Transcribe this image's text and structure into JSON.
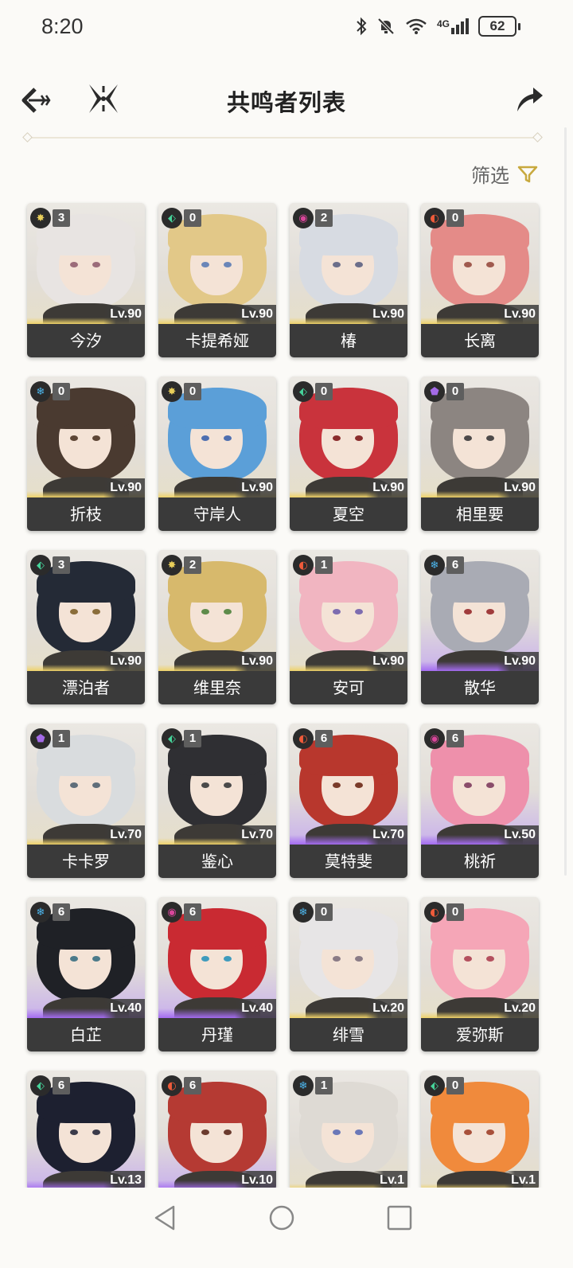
{
  "status_bar": {
    "time": "8:20",
    "network": "4G",
    "battery": "62"
  },
  "header": {
    "title": "共鸣者列表"
  },
  "filter": {
    "label": "筛选"
  },
  "colors": {
    "accent": "#c8a93e",
    "card_name_bg": "#3a3a3a",
    "rarity_gold": "#efd36a",
    "rarity_purple": "#a46cf0"
  },
  "characters": [
    {
      "name": "今汐",
      "level": "Lv.90",
      "constellation": "3",
      "element": "spectro",
      "rarity": "gold",
      "hair": "#e8e4e2",
      "eye": "#9b6c7a"
    },
    {
      "name": "卡提希娅",
      "level": "Lv.90",
      "constellation": "0",
      "element": "aero",
      "rarity": "gold",
      "hair": "#e2c888",
      "eye": "#6a86b8"
    },
    {
      "name": "椿",
      "level": "Lv.90",
      "constellation": "2",
      "element": "havoc",
      "rarity": "gold",
      "hair": "#d7dbe2",
      "eye": "#6b6e8a"
    },
    {
      "name": "长离",
      "level": "Lv.90",
      "constellation": "0",
      "element": "fusion",
      "rarity": "gold",
      "hair": "#e48b88",
      "eye": "#a05a4e"
    },
    {
      "name": "折枝",
      "level": "Lv.90",
      "constellation": "0",
      "element": "glacio",
      "rarity": "gold",
      "hair": "#4a3a30",
      "eye": "#5d4636"
    },
    {
      "name": "守岸人",
      "level": "Lv.90",
      "constellation": "0",
      "element": "spectro",
      "rarity": "gold",
      "hair": "#5b9fd8",
      "eye": "#4e6fb0"
    },
    {
      "name": "夏空",
      "level": "Lv.90",
      "constellation": "0",
      "element": "aero",
      "rarity": "gold",
      "hair": "#c9333c",
      "eye": "#8a2c2c"
    },
    {
      "name": "相里要",
      "level": "Lv.90",
      "constellation": "0",
      "element": "electro",
      "rarity": "gold",
      "hair": "#8c8581",
      "eye": "#4d4a4a"
    },
    {
      "name": "漂泊者",
      "level": "Lv.90",
      "constellation": "3",
      "element": "aero",
      "rarity": "gold",
      "hair": "#242a36",
      "eye": "#8a6d3a"
    },
    {
      "name": "维里奈",
      "level": "Lv.90",
      "constellation": "2",
      "element": "spectro",
      "rarity": "gold",
      "hair": "#d7b96c",
      "eye": "#5e8b4a"
    },
    {
      "name": "安可",
      "level": "Lv.90",
      "constellation": "1",
      "element": "fusion",
      "rarity": "gold",
      "hair": "#f1b5c1",
      "eye": "#7d6cb0"
    },
    {
      "name": "散华",
      "level": "Lv.90",
      "constellation": "6",
      "element": "glacio",
      "rarity": "purple",
      "hair": "#a9abb4",
      "eye": "#a03c3c"
    },
    {
      "name": "卡卡罗",
      "level": "Lv.70",
      "constellation": "1",
      "element": "electro",
      "rarity": "gold",
      "hair": "#d9dcde",
      "eye": "#5f6e7a"
    },
    {
      "name": "鉴心",
      "level": "Lv.70",
      "constellation": "1",
      "element": "aero",
      "rarity": "gold",
      "hair": "#2f2f33",
      "eye": "#4a4a4a"
    },
    {
      "name": "莫特斐",
      "level": "Lv.70",
      "constellation": "6",
      "element": "fusion",
      "rarity": "purple",
      "hair": "#b8372d",
      "eye": "#7a3b2a"
    },
    {
      "name": "桃祈",
      "level": "Lv.50",
      "constellation": "6",
      "element": "havoc",
      "rarity": "purple",
      "hair": "#ee90ab",
      "eye": "#8a4c6a"
    },
    {
      "name": "白芷",
      "level": "Lv.40",
      "constellation": "6",
      "element": "glacio",
      "rarity": "purple",
      "hair": "#1f2126",
      "eye": "#4b7a8a"
    },
    {
      "name": "丹瑾",
      "level": "Lv.40",
      "constellation": "6",
      "element": "havoc",
      "rarity": "purple",
      "hair": "#c92a32",
      "eye": "#3f9bbd"
    },
    {
      "name": "绯雪",
      "level": "Lv.20",
      "constellation": "0",
      "element": "glacio",
      "rarity": "gold",
      "hair": "#e7e5e6",
      "eye": "#8a7b86"
    },
    {
      "name": "爱弥斯",
      "level": "Lv.20",
      "constellation": "0",
      "element": "fusion",
      "rarity": "gold",
      "hair": "#f5a6b7",
      "eye": "#b4505e"
    },
    {
      "name": "",
      "level": "Lv.13",
      "constellation": "6",
      "element": "aero",
      "rarity": "purple",
      "hair": "#1d2030",
      "eye": "#3b3b4a"
    },
    {
      "name": "",
      "level": "Lv.10",
      "constellation": "6",
      "element": "fusion",
      "rarity": "purple",
      "hair": "#b53a33",
      "eye": "#6b3b2e"
    },
    {
      "name": "",
      "level": "Lv.1",
      "constellation": "1",
      "element": "glacio",
      "rarity": "gold",
      "hair": "#dedad4",
      "eye": "#6a78b8"
    },
    {
      "name": "",
      "level": "Lv.1",
      "constellation": "0",
      "element": "aero",
      "rarity": "gold",
      "hair": "#f08a3c",
      "eye": "#a8503a"
    }
  ]
}
